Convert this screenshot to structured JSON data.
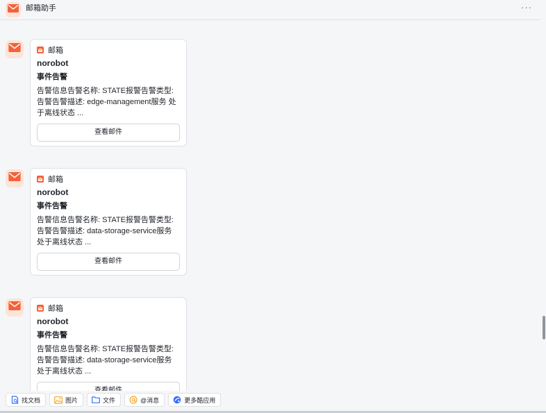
{
  "header": {
    "title": "邮箱助手",
    "more": "···",
    "avatar_icon": "mail-icon",
    "accent": "#f4623a"
  },
  "messages": [
    {
      "source_label": "邮箱",
      "sender": "norobot",
      "subject": "事件告警",
      "body": "告警信息告警名称: STATE报警告警类型: 告警告警描述: edge-management服务 处于离线状态  ...",
      "button": "查看邮件"
    },
    {
      "source_label": "邮箱",
      "sender": "norobot",
      "subject": "事件告警",
      "body": "告警信息告警名称: STATE报警告警类型: 告警告警描述: data-storage-service服务 处于离线状态  ...",
      "button": "查看邮件"
    },
    {
      "source_label": "邮箱",
      "sender": "norobot",
      "subject": "事件告警",
      "body": "告警信息告警名称: STATE报警告警类型: 告警告警描述: data-storage-service服务 处于离线状态  ...",
      "button": "查看邮件"
    }
  ],
  "toolbar": {
    "items": [
      {
        "label": "找文档",
        "icon": "find-doc-icon"
      },
      {
        "label": "图片",
        "icon": "image-icon"
      },
      {
        "label": "文件",
        "icon": "folder-icon"
      },
      {
        "label": "@消息",
        "icon": "at-icon"
      },
      {
        "label": "更多酷应用",
        "icon": "apps-icon"
      }
    ]
  }
}
